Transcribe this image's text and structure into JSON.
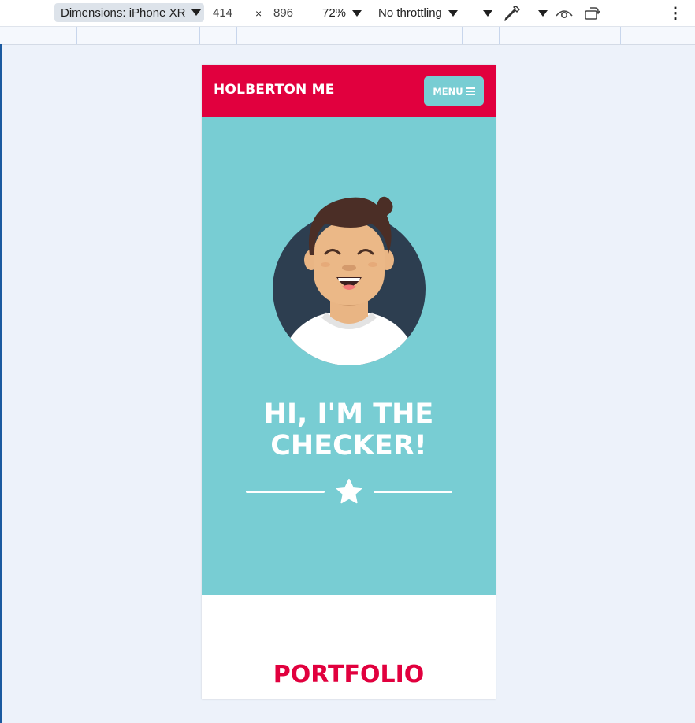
{
  "devtools": {
    "device_label": "Dimensions: iPhone XR",
    "width_value": "414",
    "times_sign": "×",
    "height_value": "896",
    "zoom": "72%",
    "throttling": "No throttling",
    "more_icon": "⋮"
  },
  "site": {
    "brand": "HOLBERTON ME",
    "menu_label": "MENU",
    "hero_line1": "HI, I'M THE",
    "hero_line2": "CHECKER!",
    "section_title": "PORTFOLIO"
  },
  "colors": {
    "primary_red": "#e1003e",
    "teal": "#78cdd3",
    "avatar_bg": "#2d3e50"
  }
}
